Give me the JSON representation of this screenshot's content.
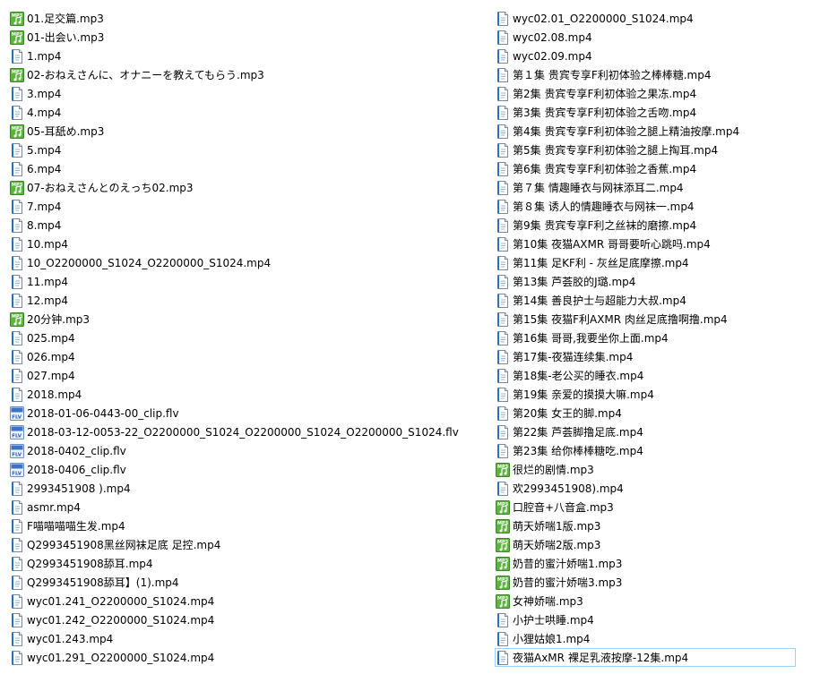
{
  "files_left": [
    {
      "name": "01.足交篇.mp3",
      "type": "mp3"
    },
    {
      "name": "01-出会い.mp3",
      "type": "mp3"
    },
    {
      "name": "1.mp4",
      "type": "mp4"
    },
    {
      "name": "02-おねえさんに、オナニーを教えてもらう.mp3",
      "type": "mp3"
    },
    {
      "name": "3.mp4",
      "type": "mp4"
    },
    {
      "name": "4.mp4",
      "type": "mp4"
    },
    {
      "name": "05-耳舐め.mp3",
      "type": "mp3"
    },
    {
      "name": "5.mp4",
      "type": "mp4"
    },
    {
      "name": "6.mp4",
      "type": "mp4"
    },
    {
      "name": "07-おねえさんとのえっち02.mp3",
      "type": "mp3"
    },
    {
      "name": "7.mp4",
      "type": "mp4"
    },
    {
      "name": "8.mp4",
      "type": "mp4"
    },
    {
      "name": "10.mp4",
      "type": "mp4"
    },
    {
      "name": "10_O2200000_S1024_O2200000_S1024.mp4",
      "type": "mp4"
    },
    {
      "name": "11.mp4",
      "type": "mp4"
    },
    {
      "name": "12.mp4",
      "type": "mp4"
    },
    {
      "name": "20分钟.mp3",
      "type": "mp3"
    },
    {
      "name": "025.mp4",
      "type": "mp4"
    },
    {
      "name": "026.mp4",
      "type": "mp4"
    },
    {
      "name": "027.mp4",
      "type": "mp4"
    },
    {
      "name": "2018.mp4",
      "type": "mp4"
    },
    {
      "name": "2018-01-06-0443-00_clip.flv",
      "type": "flv"
    },
    {
      "name": "2018-03-12-0053-22_O2200000_S1024_O2200000_S1024_O2200000_S1024.flv",
      "type": "flv"
    },
    {
      "name": "2018-0402_clip.flv",
      "type": "flv"
    },
    {
      "name": "2018-0406_clip.flv",
      "type": "flv"
    },
    {
      "name": "2993451908 ).mp4",
      "type": "mp4"
    },
    {
      "name": "asmr.mp4",
      "type": "mp4"
    },
    {
      "name": "F喵喵喵喵生发.mp4",
      "type": "mp4"
    },
    {
      "name": "Q2993451908黑丝网袜足底  足控.mp4",
      "type": "mp4"
    },
    {
      "name": "Q2993451908舔耳.mp4",
      "type": "mp4"
    },
    {
      "name": "Q2993451908舔耳】(1).mp4",
      "type": "mp4"
    },
    {
      "name": "wyc01.241_O2200000_S1024.mp4",
      "type": "mp4"
    },
    {
      "name": "wyc01.242_O2200000_S1024.mp4",
      "type": "mp4"
    },
    {
      "name": "wyc01.243.mp4",
      "type": "mp4"
    },
    {
      "name": "wyc01.291_O2200000_S1024.mp4",
      "type": "mp4"
    }
  ],
  "files_right": [
    {
      "name": "wyc02.01_O2200000_S1024.mp4",
      "type": "mp4"
    },
    {
      "name": "wyc02.08.mp4",
      "type": "mp4"
    },
    {
      "name": "wyc02.09.mp4",
      "type": "mp4"
    },
    {
      "name": "第１集  贵宾专享F利初体验之棒棒糖.mp4",
      "type": "mp4"
    },
    {
      "name": "第2集  贵宾专享F利初体验之果冻.mp4",
      "type": "mp4"
    },
    {
      "name": "第3集  贵宾专享F利初体验之舌吻.mp4",
      "type": "mp4"
    },
    {
      "name": "第4集  贵宾专享F利初体验之腿上精油按摩.mp4",
      "type": "mp4"
    },
    {
      "name": "第5集  贵宾专享F利初体验之腿上掏耳.mp4",
      "type": "mp4"
    },
    {
      "name": "第6集  贵宾专享F利初体验之香蕉.mp4",
      "type": "mp4"
    },
    {
      "name": "第７集 情趣睡衣与网袜添耳二.mp4",
      "type": "mp4"
    },
    {
      "name": "第８集 诱人的情趣睡衣与网袜一.mp4",
      "type": "mp4"
    },
    {
      "name": "第9集 贵宾专享F利之丝袜的磨擦.mp4",
      "type": "mp4"
    },
    {
      "name": "第10集 夜猫AXMR 哥哥要听心跳吗.mp4",
      "type": "mp4"
    },
    {
      "name": "第11集 足KF利 - 灰丝足底摩擦.mp4",
      "type": "mp4"
    },
    {
      "name": "第13集 芦荟胶的J璐.mp4",
      "type": "mp4"
    },
    {
      "name": "第14集 善良护士与超能力大叔.mp4",
      "type": "mp4"
    },
    {
      "name": "第15集 夜猫F利AXMR 肉丝足底撸啊撸.mp4",
      "type": "mp4"
    },
    {
      "name": "第16集  哥哥,我要坐你上面.mp4",
      "type": "mp4"
    },
    {
      "name": "第17集-夜猫连续集.mp4",
      "type": "mp4"
    },
    {
      "name": "第18集-老公买的睡衣.mp4",
      "type": "mp4"
    },
    {
      "name": "第19集 亲爱的摸摸大嘛.mp4",
      "type": "mp4"
    },
    {
      "name": "第20集 女王的脚.mp4",
      "type": "mp4"
    },
    {
      "name": "第22集 芦荟脚撸足底.mp4",
      "type": "mp4"
    },
    {
      "name": "第23集 给你棒棒糖吃.mp4",
      "type": "mp4"
    },
    {
      "name": "很烂的剧情.mp3",
      "type": "mp3"
    },
    {
      "name": "欢2993451908).mp4",
      "type": "mp4"
    },
    {
      "name": "口腔音+八音盒.mp3",
      "type": "mp3"
    },
    {
      "name": "萌天娇喘1版.mp3",
      "type": "mp3"
    },
    {
      "name": "萌天娇喘2版.mp3",
      "type": "mp3"
    },
    {
      "name": "奶昔的蜜汁娇喘1.mp3",
      "type": "mp3"
    },
    {
      "name": "奶昔的蜜汁娇喘3.mp3",
      "type": "mp3"
    },
    {
      "name": "女神娇喘.mp3",
      "type": "mp3"
    },
    {
      "name": "小护士哄睡.mp4",
      "type": "mp4"
    },
    {
      "name": "小狸姑娘1.mp4",
      "type": "mp4"
    },
    {
      "name": "夜猫AxMR 裸足乳液按摩-12集.mp4",
      "type": "mp4",
      "selected": true
    }
  ],
  "icons": {
    "mp3": "mp3-file-icon",
    "mp4": "mp4-file-icon",
    "flv": "flv-file-icon"
  },
  "colors": {
    "selection_border": "#99d1ff",
    "mp3_green": "#4caf3a",
    "doc_blue": "#2a6fc9"
  }
}
